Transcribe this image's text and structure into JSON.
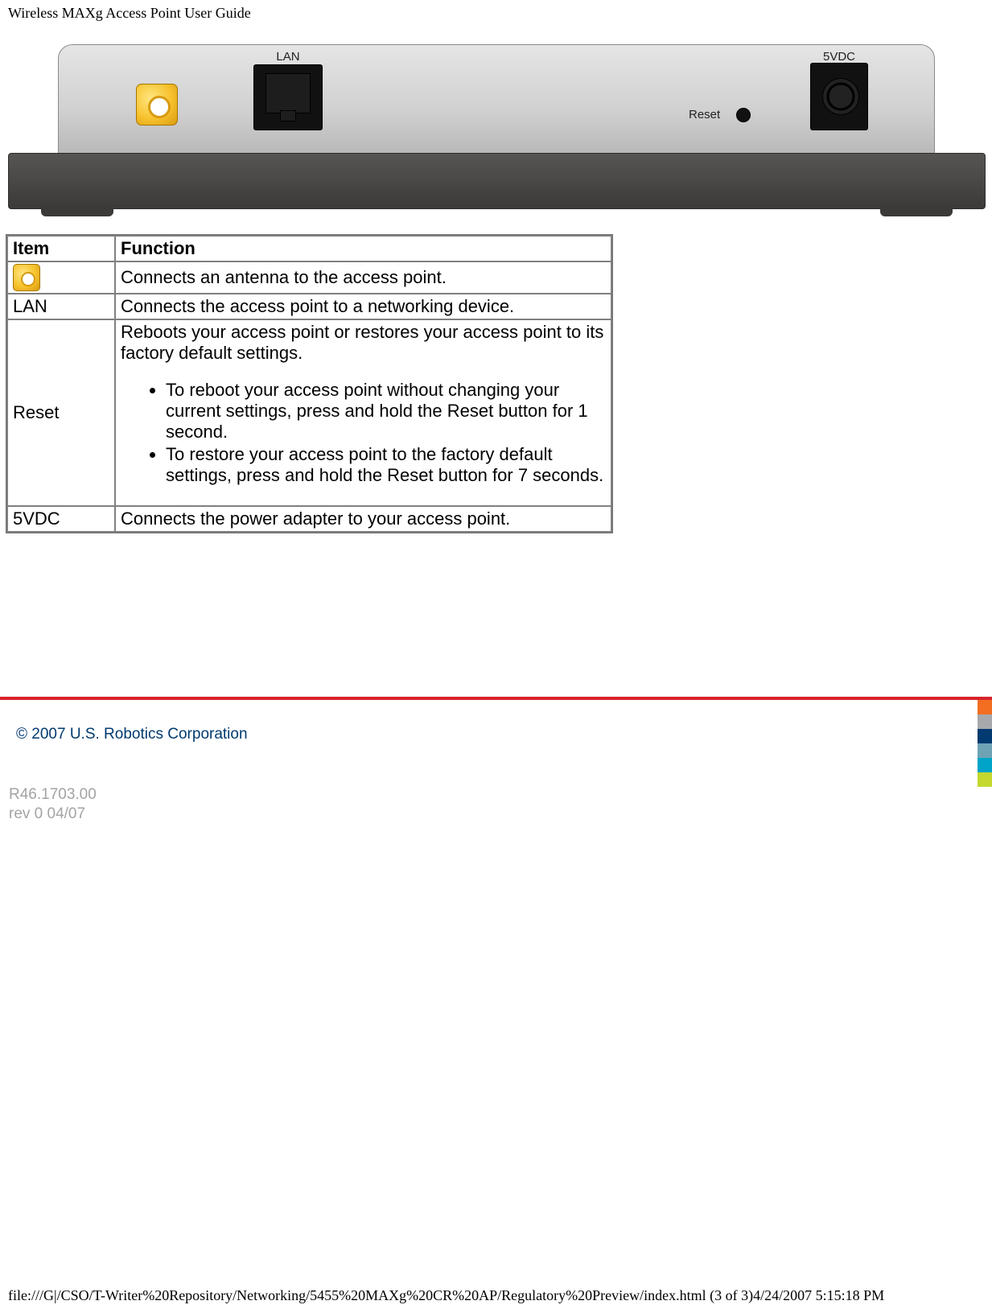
{
  "header": {
    "title": "Wireless MAXg Access Point User Guide"
  },
  "device": {
    "labels": {
      "lan": "LAN",
      "reset": "Reset",
      "vdc": "5VDC"
    }
  },
  "table": {
    "headers": {
      "item": "Item",
      "function": "Function"
    },
    "rows": {
      "antenna": {
        "function_text": "Connects an antenna to the access point."
      },
      "lan": {
        "item": "LAN",
        "function_text": "Connects the access point to a networking device."
      },
      "reset": {
        "item": "Reset",
        "intro": "Reboots your access point or restores your access point to its factory default settings.",
        "bullet1": "To reboot your access point without changing your current settings, press and hold the Reset button for 1 second.",
        "bullet2": "To restore your access point to the factory default settings, press and hold the Reset button for 7 seconds."
      },
      "vdc": {
        "item": "5VDC",
        "function_text": "Connects the power adapter to your access point."
      }
    }
  },
  "footer": {
    "copyright": "© 2007 U.S. Robotics Corporation",
    "rev_line1": "R46.1703.00",
    "rev_line2": "rev 0 04/07",
    "path": "file:///G|/CSO/T-Writer%20Repository/Networking/5455%20MAXg%20CR%20AP/Regulatory%20Preview/index.html (3 of 3)4/24/2007 5:15:18 PM"
  }
}
